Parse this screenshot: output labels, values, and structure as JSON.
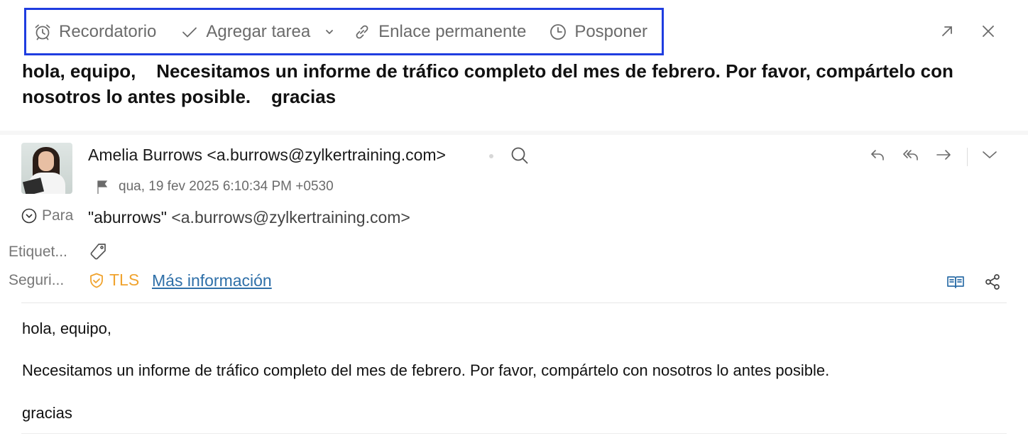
{
  "toolbar": {
    "reminder_label": "Recordatorio",
    "task_label": "Agregar tarea",
    "permalink_label": "Enlace permanente",
    "snooze_label": "Posponer",
    "highlight_color": "#1f3de0"
  },
  "subject": "hola, equipo,    Necesitamos un informe de tráfico completo del mes de febrero. Por favor, compártelo con nosotros lo antes posible.    gracias",
  "sender": {
    "display": "Amelia Burrows <a.burrows@zylkertraining.com>",
    "date": "qua, 19 fev 2025 6:10:34 PM +0530"
  },
  "recipients": {
    "label": "Para",
    "name": "\"aburrows\"",
    "address": "<a.burrows@zylkertraining.com>"
  },
  "tags": {
    "label": "Etiquet..."
  },
  "security": {
    "label": "Seguri...",
    "tls_text": "TLS",
    "tls_color": "#f0a32e",
    "more_info": "Más información",
    "link_color": "#2e6fa8"
  },
  "body": {
    "greeting": "hola, equipo,",
    "content": "Necesitamos un informe de tráfico completo del mes de febrero. Por favor, compártelo con nosotros lo antes posible.",
    "closing": "gracias"
  },
  "icons": {
    "toolbar": [
      "alarm-clock-icon",
      "checkmark-icon",
      "chevron-down-icon",
      "link-icon",
      "clock-icon"
    ],
    "window": [
      "expand-icon",
      "close-icon"
    ],
    "actions": [
      "reply-icon",
      "reply-all-icon",
      "forward-icon",
      "chevron-down-icon"
    ],
    "other": [
      "search-icon",
      "flag-icon",
      "chevron-circle-icon",
      "tag-icon",
      "shield-check-icon",
      "reader-mode-icon",
      "share-icon"
    ]
  }
}
